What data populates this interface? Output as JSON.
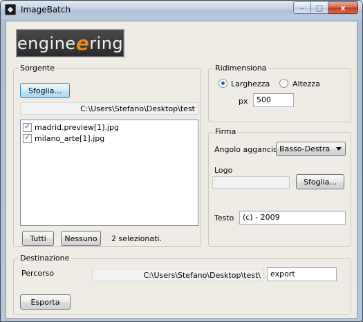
{
  "window": {
    "title": "ImageBatch",
    "controls": {
      "minimize": "–",
      "maximize": "□",
      "close": "x"
    }
  },
  "logo": {
    "before": "engine",
    "highlight": "e",
    "after": "ring"
  },
  "sorgente": {
    "group_label": "Sorgente",
    "browse_label": "Sfoglia...",
    "path": "C:\\Users\\Stefano\\Desktop\\test",
    "files": [
      {
        "name": "madrid.preview[1].jpg",
        "checked": true
      },
      {
        "name": "milano_arte[1].jpg",
        "checked": true
      }
    ],
    "all_label": "Tutti",
    "none_label": "Nessuno",
    "selected_status": "2 selezionati."
  },
  "ridimensiona": {
    "group_label": "Ridimensiona",
    "width_label": "Larghezza",
    "height_label": "Altezza",
    "selected": "Larghezza",
    "unit_label": "px",
    "value": "500"
  },
  "firma": {
    "group_label": "Firma",
    "corner_label": "Angolo aggancio",
    "corner_value": "Basso-Destra",
    "logo_label": "Logo",
    "logo_path": "",
    "browse_label": "Sfoglia...",
    "text_label": "Testo",
    "text_value": "(c) - 2009"
  },
  "destinazione": {
    "group_label": "Destinazione",
    "path_label": "Percorso",
    "path": "C:\\Users\\Stefano\\Desktop\\test\\",
    "folder": "export",
    "export_label": "Esporta"
  },
  "icons": {
    "app": "imagebatch-app-icon",
    "check": "✓"
  }
}
